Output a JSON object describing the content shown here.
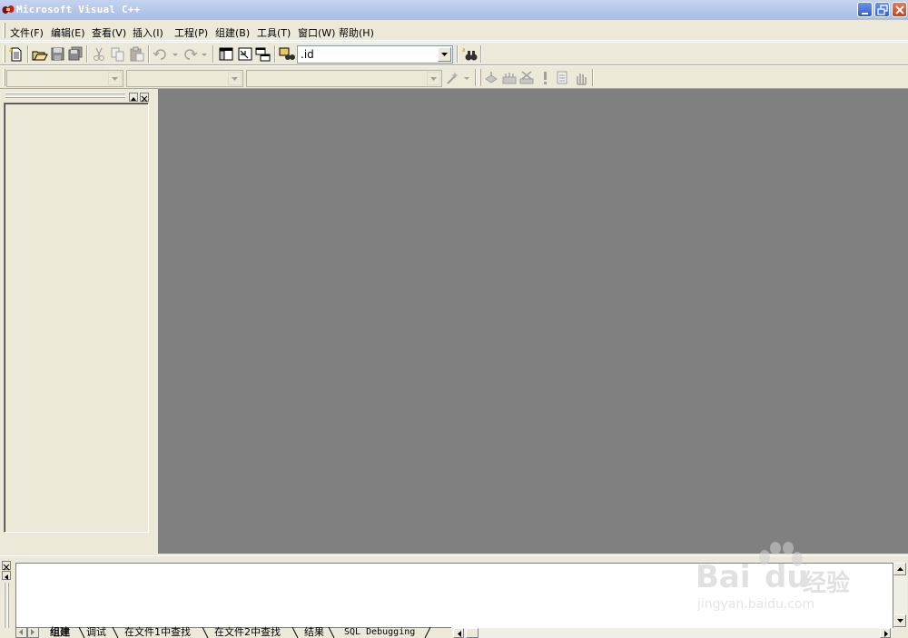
{
  "window": {
    "title": "Microsoft Visual C++",
    "app_icon": "vc-app-icon",
    "controls": {
      "minimize_icon": "minimize-icon",
      "restore_icon": "restore-icon",
      "close_icon": "close-icon"
    }
  },
  "menu": {
    "items": [
      {
        "label": "文件(F)"
      },
      {
        "label": "编辑(E)"
      },
      {
        "label": "查看(V)"
      },
      {
        "label": "插入(I)"
      },
      {
        "label": "工程(P)"
      },
      {
        "label": "组建(B)"
      },
      {
        "label": "工具(T)"
      },
      {
        "label": "窗口(W)"
      },
      {
        "label": "帮助(H)"
      }
    ]
  },
  "standard_toolbar": {
    "buttons": [
      "new-text-file-icon",
      "open-icon",
      "save-icon",
      "save-all-icon",
      "cut-icon",
      "copy-icon",
      "paste-icon",
      "undo-icon",
      "redo-icon",
      "workspace-icon",
      "output-icon",
      "window-list-icon",
      "find-in-files-icon"
    ],
    "find_combo_value": ".id",
    "search_button": "binoculars-icon"
  },
  "wizardbar": {
    "class_combo": "",
    "filter_combo": "",
    "members_combo": "",
    "action_icon": "wand-icon"
  },
  "build_minibar": {
    "buttons": [
      "compile-icon",
      "build-icon",
      "stop-build-icon",
      "execute-icon",
      "go-icon",
      "breakpoint-icon"
    ]
  },
  "output": {
    "tabs": [
      {
        "label": "组建",
        "active": true
      },
      {
        "label": "调试",
        "active": false
      },
      {
        "label": "在文件1中查找",
        "active": false
      },
      {
        "label": "在文件2中查找",
        "active": false
      },
      {
        "label": "结果",
        "active": false
      },
      {
        "label": "SQL Debugging",
        "active": false
      }
    ]
  },
  "watermark": {
    "brand": "Bai",
    "brand2": "du",
    "cn": "经验",
    "url": "jingyan.baidu.com"
  },
  "colors": {
    "titlebar": "#a9bde6",
    "chrome": "#ece9d8",
    "mdi_background": "#808080"
  }
}
